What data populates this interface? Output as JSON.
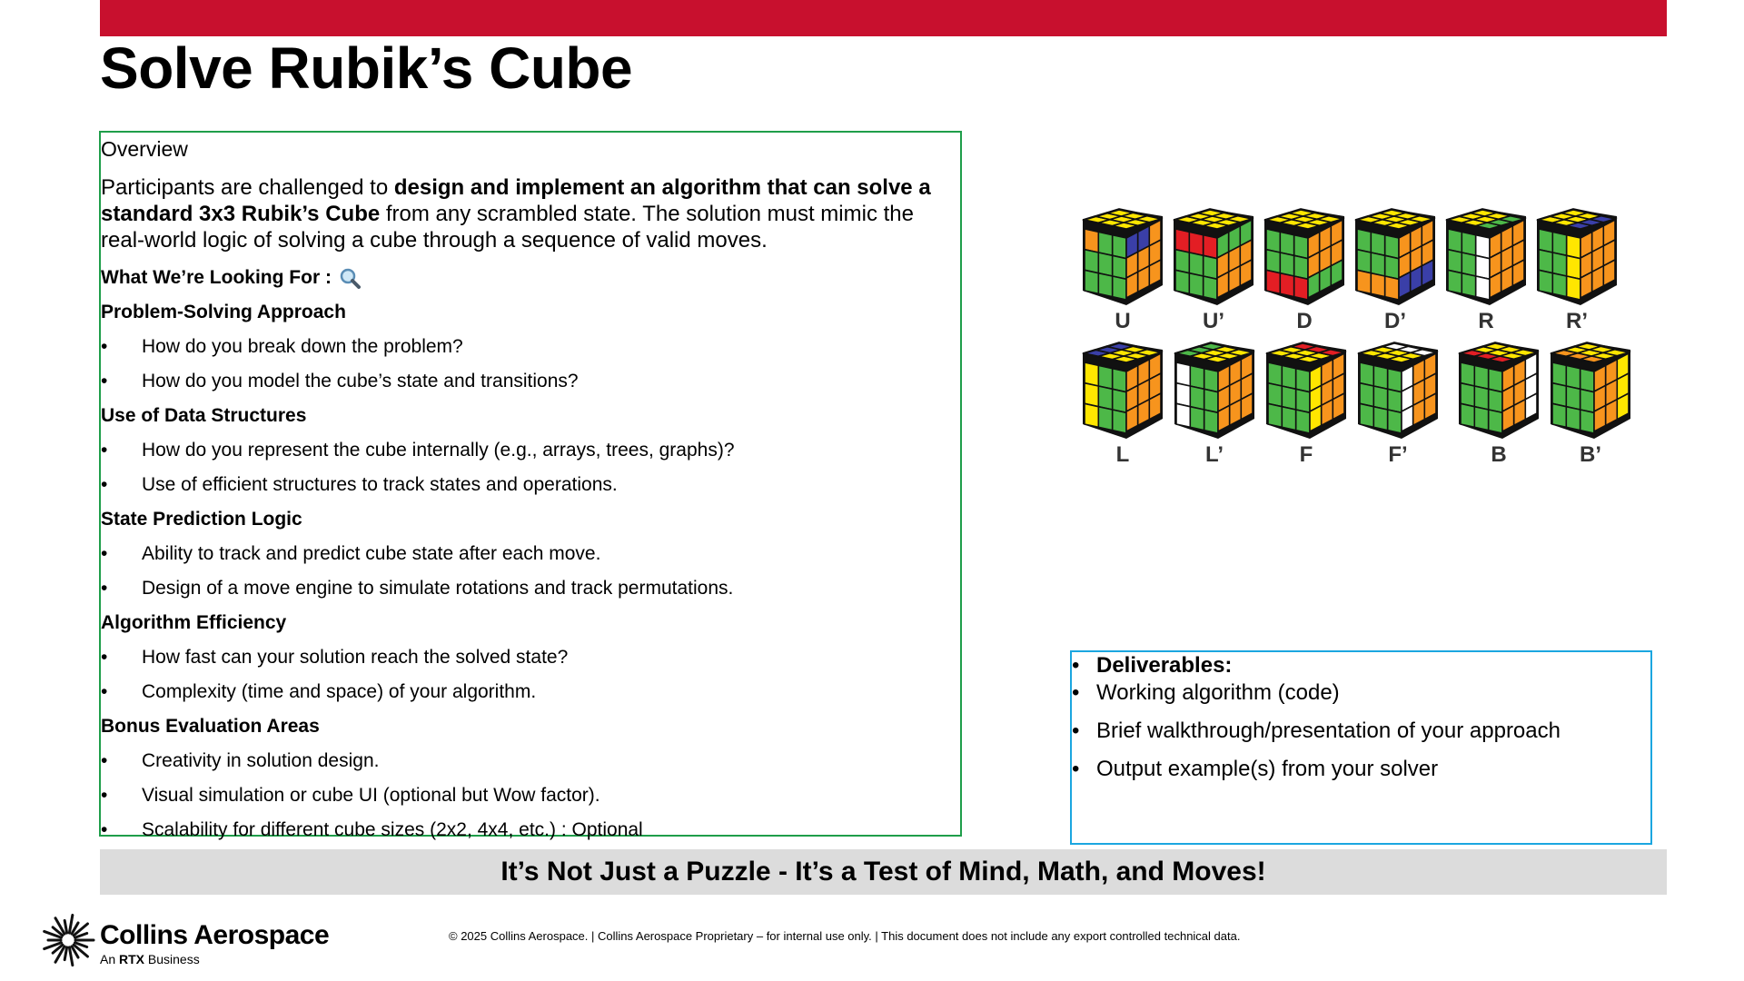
{
  "title": "Solve Rubik’s Cube",
  "overview": {
    "heading": "Overview",
    "intro_plain_1": "Participants are challenged to ",
    "intro_bold": "design and implement an algorithm that can solve a standard 3x3 Rubik’s Cube",
    "intro_plain_2": " from any scrambled state. The solution must mimic the real-world logic of solving a cube through a sequence of valid moves.",
    "looking_for": "What We’re Looking For :",
    "looking_for_icon": "magnifier-icon",
    "bullet_char": "•",
    "sections": [
      {
        "title": "Problem-Solving Approach",
        "items": [
          "How do you break down the problem?",
          "How do you model the cube’s state and transitions?"
        ]
      },
      {
        "title": "Use of Data Structures",
        "items": [
          "How do you represent the cube internally (e.g., arrays, trees, graphs)?",
          "Use of efficient structures to track states and operations."
        ]
      },
      {
        "title": "State Prediction Logic",
        "items": [
          "Ability to track and predict cube state after each move.",
          "Design of a move engine to simulate rotations and track permutations."
        ]
      },
      {
        "title": "Algorithm Efficiency",
        "items": [
          "How fast can your solution reach the solved state?",
          "Complexity (time and space) of your algorithm."
        ]
      },
      {
        "title": "Bonus Evaluation Areas",
        "items": [
          "Creativity in solution design.",
          "Visual simulation or cube UI (optional but Wow factor).",
          "Scalability for different cube sizes (2x2, 4x4, etc.) : Optional"
        ]
      }
    ]
  },
  "moves": [
    "U",
    "U’",
    "D",
    "D’",
    "R",
    "R’",
    "L",
    "L’",
    "F",
    "F’",
    "B",
    "B’"
  ],
  "deliverables": {
    "heading": "Deliverables:",
    "items": [
      "Working algorithm (code)",
      "Brief walkthrough/presentation of your approach",
      "Output example(s) from your solver"
    ]
  },
  "banner": "It’s Not Just a Puzzle - It’s a Test of Mind, Math, and Moves!",
  "logo": {
    "brand": "Collins Aerospace",
    "tagline_pre": "An ",
    "tagline_bold": "RTX",
    "tagline_post": " Business",
    "icon": "sunburst-logo-icon"
  },
  "footer": "© 2025 Collins Aerospace. | Collins Aerospace Proprietary – for internal use only. | This document does not include any export controlled technical data.",
  "colors": {
    "topbar": "#c8102e",
    "left_border": "#1f9e4a",
    "right_border": "#1ba6e0",
    "banner_bg": "#dcdcdc",
    "cube_green": "#4db848",
    "cube_orange": "#f7941d",
    "cube_yellow": "#ffe600",
    "cube_red": "#e31e24",
    "cube_blue": "#3a3fa8",
    "cube_white": "#ffffff"
  }
}
